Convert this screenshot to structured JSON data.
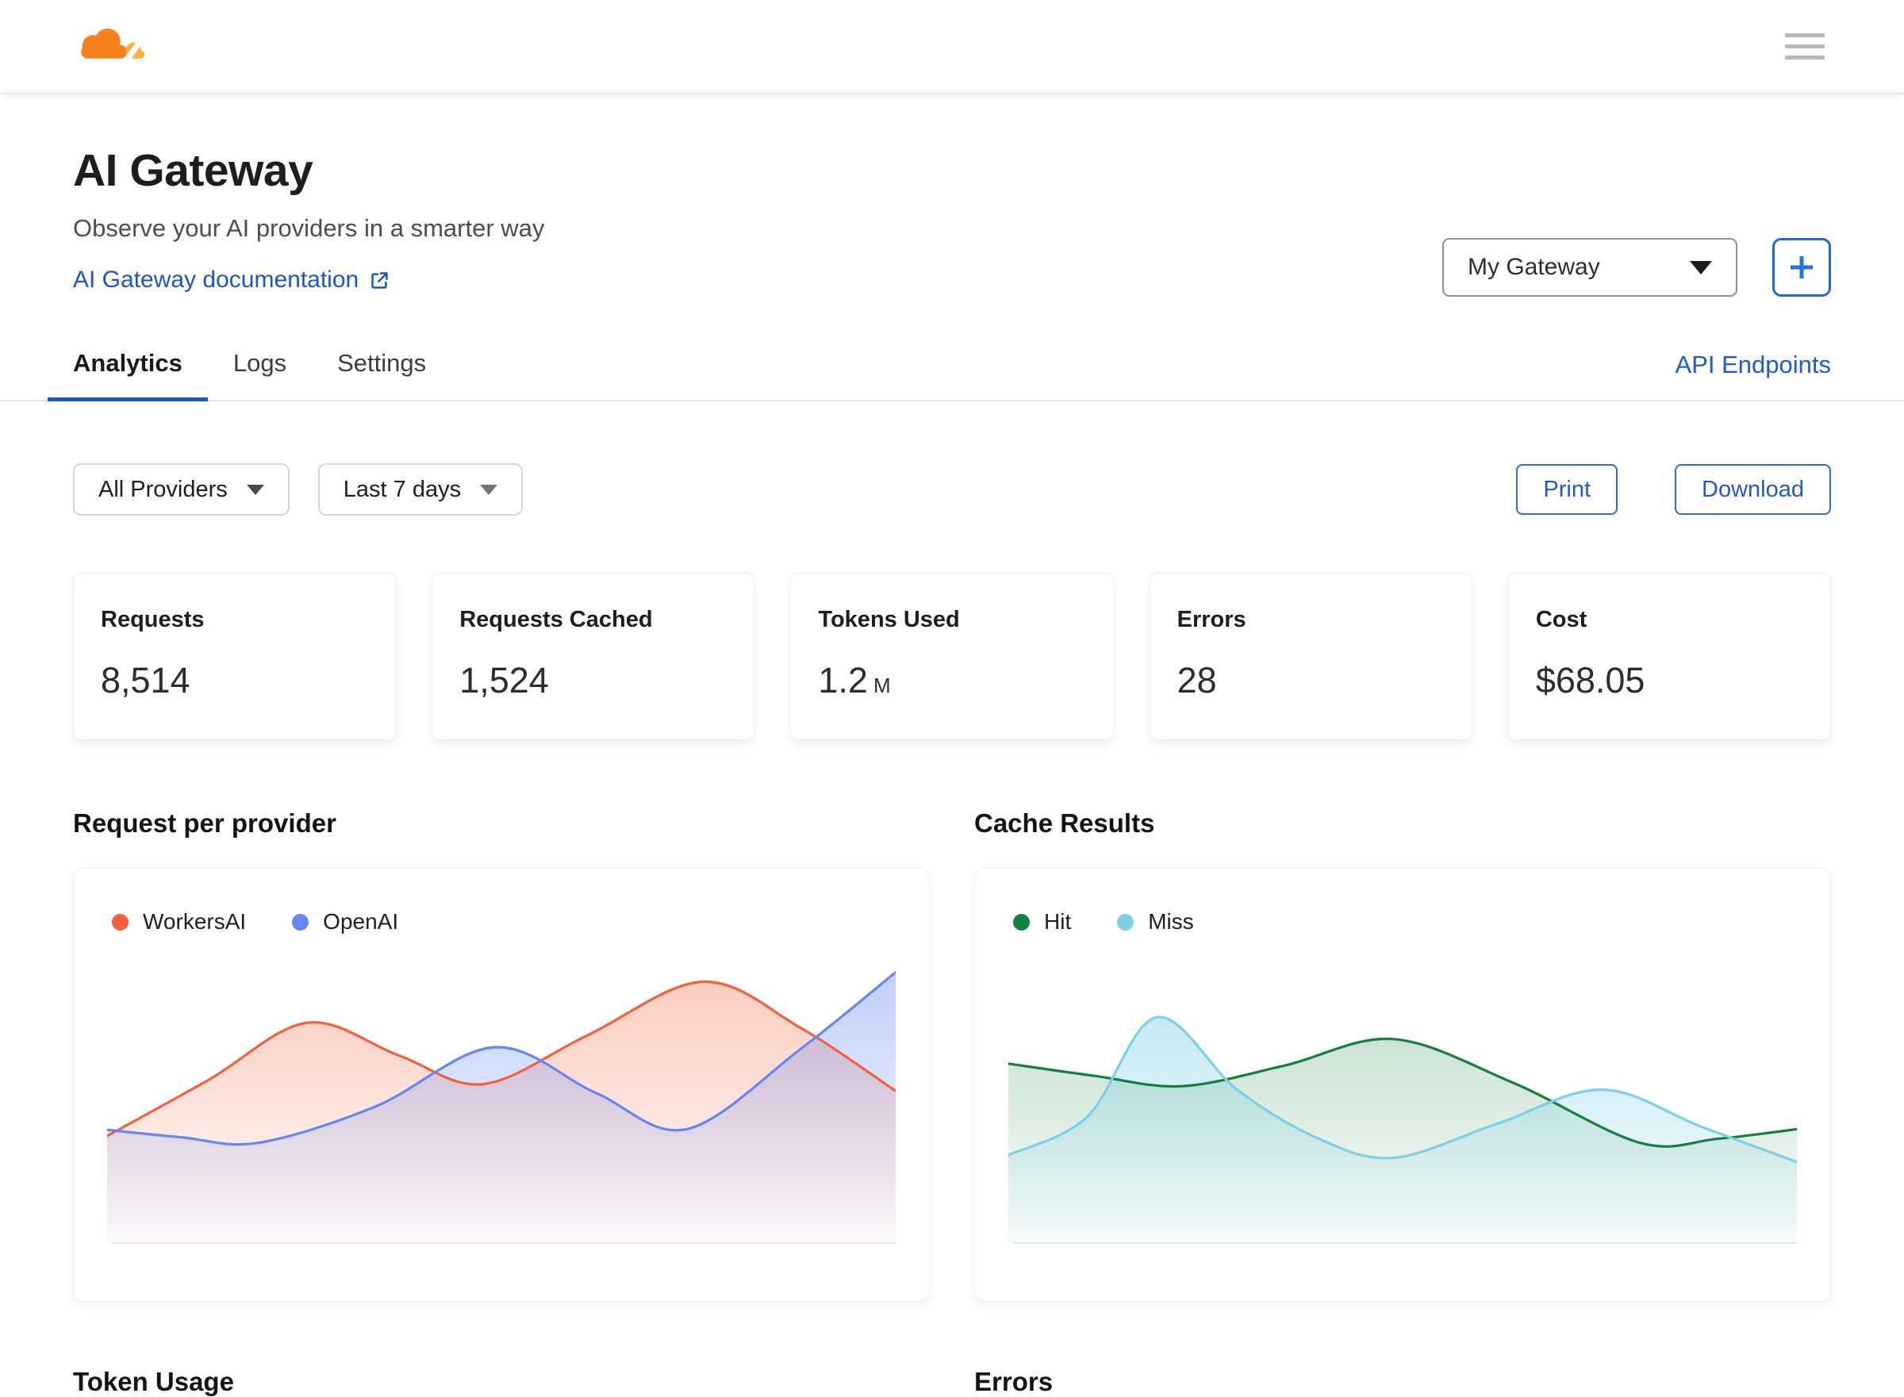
{
  "header": {
    "logo_icon": "cloudflare-cloud-logo",
    "menu_icon": "hamburger-menu"
  },
  "page": {
    "title": "AI Gateway",
    "subtitle": "Observe your AI providers in a smarter way",
    "doc_link_label": "AI Gateway documentation",
    "doc_link_icon": "external-link",
    "gateway_select": {
      "value": "My Gateway",
      "icon": "triangle-caret-down"
    },
    "add_button_icon": "plus"
  },
  "tabs": [
    {
      "label": "Analytics",
      "active": true
    },
    {
      "label": "Logs",
      "active": false
    },
    {
      "label": "Settings",
      "active": false
    }
  ],
  "api_endpoints_link": "API Endpoints",
  "filters": {
    "provider": {
      "value": "All Providers",
      "icon": "triangle-caret-down"
    },
    "date_range": {
      "value": "Last 7 days",
      "icon": "triangle-caret-down"
    }
  },
  "actions": {
    "print_label": "Print",
    "download_label": "Download"
  },
  "stats": [
    {
      "label": "Requests",
      "value": "8,514",
      "suffix": ""
    },
    {
      "label": "Requests Cached",
      "value": "1,524",
      "suffix": ""
    },
    {
      "label": "Tokens Used",
      "value": "1.2",
      "suffix": "M"
    },
    {
      "label": "Errors",
      "value": "28",
      "suffix": ""
    },
    {
      "label": "Cost",
      "value": "$68.05",
      "suffix": ""
    }
  ],
  "colors": {
    "brand_orange": "#f6821f",
    "brand_orange_light": "#fbad41",
    "link_blue": "#1b56c9",
    "button_blue": "#2d6ae4",
    "active_tab_blue": "#1f55c8",
    "workersai": "#f4603a",
    "openai": "#6487f3",
    "hit": "#15803c",
    "miss": "#7ccfe6"
  },
  "chart_data": [
    {
      "type": "area",
      "title": "Request per provider",
      "legend_position": "top-left",
      "grid": false,
      "x_axis": {
        "tick_labels_visible": false
      },
      "y_axis": {
        "tick_labels_visible": false,
        "range_pct": [
          0,
          100
        ]
      },
      "series": [
        {
          "name": "WorkersAI",
          "color": "#f4603a",
          "fill_top_opacity": 0.32,
          "values_pct": [
            38,
            58,
            78,
            66,
            56,
            74,
            92,
            76,
            54
          ],
          "points": [
            [
              0,
              258
            ],
            [
              130,
              175
            ],
            [
              254,
              92
            ],
            [
              370,
              140
            ],
            [
              477,
              182
            ],
            [
              610,
              110
            ],
            [
              756,
              32
            ],
            [
              880,
              100
            ],
            [
              1000,
              192
            ]
          ]
        },
        {
          "name": "OpenAI",
          "color": "#6487f3",
          "fill_top_opacity": 0.4,
          "values_pct": [
            40,
            37,
            35,
            48,
            69,
            53,
            40,
            69,
            96
          ],
          "points": [
            [
              0,
              249
            ],
            [
              95,
              260
            ],
            [
              192,
              268
            ],
            [
              340,
              215
            ],
            [
              491,
              128
            ],
            [
              620,
              195
            ],
            [
              735,
              248
            ],
            [
              880,
              130
            ],
            [
              1000,
              18
            ]
          ]
        }
      ]
    },
    {
      "type": "area",
      "title": "Cache Results",
      "legend_position": "top-left",
      "grid": false,
      "x_axis": {
        "tick_labels_visible": false
      },
      "y_axis": {
        "tick_labels_visible": false,
        "range_pct": [
          0,
          100
        ]
      },
      "series": [
        {
          "name": "Hit",
          "color": "#15803c",
          "fill_top_opacity": 0.22,
          "values_pct": [
            63,
            59,
            55,
            63,
            72,
            57,
            35,
            37,
            40
          ],
          "points": [
            [
              0,
              152
            ],
            [
              110,
              170
            ],
            [
              220,
              185
            ],
            [
              350,
              155
            ],
            [
              488,
              116
            ],
            [
              640,
              180
            ],
            [
              801,
              268
            ],
            [
              900,
              262
            ],
            [
              1000,
              248
            ]
          ]
        },
        {
          "name": "Miss",
          "color": "#7ccfe6",
          "fill_top_opacity": 0.45,
          "values_pct": [
            31,
            45,
            80,
            54,
            37,
            30,
            42,
            54,
            41,
            29
          ],
          "points": [
            [
              0,
              286
            ],
            [
              100,
              230
            ],
            [
              188,
              84
            ],
            [
              290,
              190
            ],
            [
              390,
              260
            ],
            [
              488,
              290
            ],
            [
              620,
              240
            ],
            [
              753,
              190
            ],
            [
              880,
              245
            ],
            [
              1000,
              296
            ]
          ]
        }
      ]
    }
  ],
  "bottom_sections": {
    "left_title": "Token Usage",
    "right_title": "Errors"
  }
}
